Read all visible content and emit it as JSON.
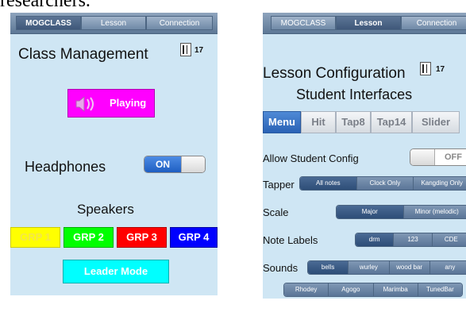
{
  "caption_fragment": "researchers.",
  "left": {
    "tabs": [
      {
        "label": "MOGCLASS",
        "selected": true
      },
      {
        "label": "Lesson",
        "selected": false
      },
      {
        "label": "Connection",
        "selected": false
      }
    ],
    "title": "Class Management",
    "badge_count": "17",
    "playing_button": "Playing",
    "headphones_label": "Headphones",
    "headphones_toggle": "ON",
    "speakers_label": "Speakers",
    "groups": [
      {
        "label": "GRP 1",
        "color": "#ffff00",
        "text_color": "#f4e64a"
      },
      {
        "label": "GRP 2",
        "color": "#00ff00",
        "text_color": "#ffffff"
      },
      {
        "label": "GRP 3",
        "color": "#ff0000",
        "text_color": "#ffffff"
      },
      {
        "label": "GRP 4",
        "color": "#0000ff",
        "text_color": "#ffffff"
      }
    ],
    "leader_button": "Leader Mode"
  },
  "right": {
    "tabs": [
      {
        "label": "MOGCLASS",
        "selected": false
      },
      {
        "label": "Lesson",
        "selected": true
      },
      {
        "label": "Connection",
        "selected": false
      }
    ],
    "title": "Lesson Configuration",
    "badge_count": "17",
    "subtitle": "Student Interfaces",
    "interfaces": [
      {
        "label": "Menu",
        "selected": true
      },
      {
        "label": "Hit",
        "selected": false
      },
      {
        "label": "Tap8",
        "selected": false
      },
      {
        "label": "Tap14",
        "selected": false
      },
      {
        "label": "Slider",
        "selected": false
      }
    ],
    "allow_label": "Allow Student Config",
    "allow_toggle": "OFF",
    "tapper_label": "Tapper",
    "tapper_options": [
      "All notes",
      "Clock Only",
      "Kangding Only"
    ],
    "scale_label": "Scale",
    "scale_options": [
      "Major",
      "Minor (melodic)"
    ],
    "note_labels_label": "Note Labels",
    "note_label_options": [
      "drm",
      "123",
      "CDE"
    ],
    "sounds_label": "Sounds",
    "sound_options": [
      "bells",
      "wurley",
      "wood bar",
      "any"
    ],
    "instrument_options": [
      "Rhodey",
      "Agogo",
      "Marimba",
      "TunedBar"
    ]
  },
  "colors": {
    "background": "#cfe6f4",
    "playing_button": "#ff00ff",
    "leader_button": "#00ffff",
    "toggle_on": "#2f6fd1",
    "selected_tab": "#2a62b5"
  }
}
